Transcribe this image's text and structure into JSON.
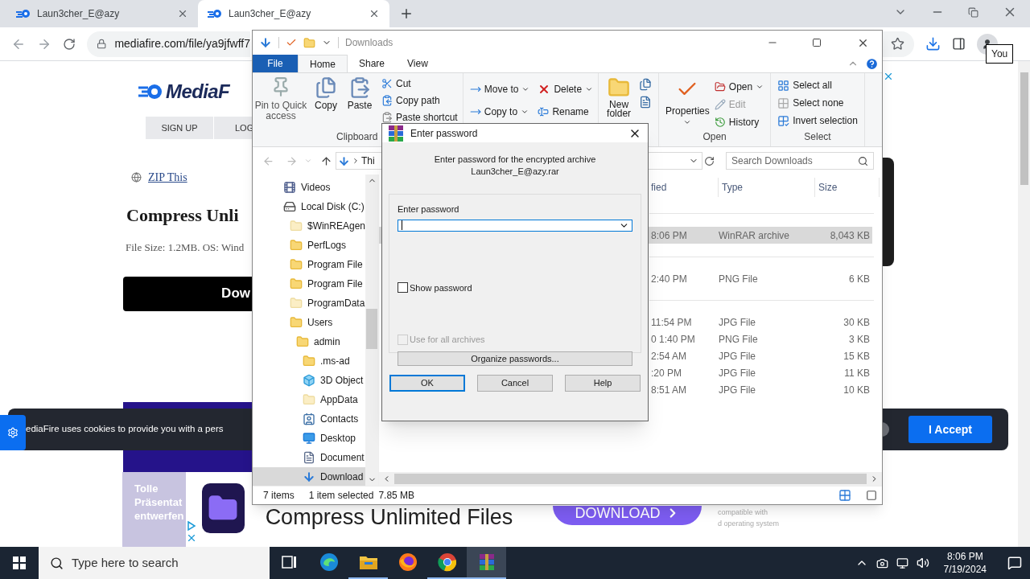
{
  "browser": {
    "tabs": [
      {
        "title": "Laun3cher_E@azy",
        "selected": false
      },
      {
        "title": "Laun3cher_E@azy",
        "selected": true
      }
    ],
    "url": "mediafire.com/file/ya9jfwff7",
    "profile_tooltip": "You"
  },
  "page": {
    "logo": "MediaF",
    "nav": [
      "SIGN UP",
      "LOG"
    ],
    "link": "ZIP This",
    "heading": "Compress Unli",
    "file_info": "File Size: 1.2MB. OS: Wind",
    "download_button": "Dow"
  },
  "cookie_bar": {
    "text": "ediaFire uses cookies to provide you with a pers",
    "accept": "I Accept"
  },
  "ad": {
    "side_text": [
      "Tolle",
      "Präsentat",
      "entwerfen"
    ],
    "headline": "Compress Unlimited Files",
    "button": "DOWNLOAD",
    "fine_print": [
      "compatible with",
      "d operating system"
    ]
  },
  "explorer": {
    "title": "Downloads",
    "file_tab": "File",
    "ribbon_tabs": [
      {
        "label": "Home",
        "selected": true
      },
      {
        "label": "Share",
        "selected": false
      },
      {
        "label": "View",
        "selected": false
      }
    ],
    "clipboard": {
      "big": [
        "Pin to Quick access",
        "Copy",
        "Paste"
      ],
      "small": [
        "Cut",
        "Copy path",
        "Paste shortcut"
      ],
      "label": "Clipboard"
    },
    "organize": [
      "Move to",
      "Copy to",
      "Delete",
      "Rename"
    ],
    "new_folder": "New folder",
    "open": {
      "big": "Properties",
      "small": [
        {
          "label": "Open",
          "disabled": false
        },
        {
          "label": "Edit",
          "disabled": true
        },
        {
          "label": "History",
          "disabled": false
        }
      ],
      "label": "Open"
    },
    "select": {
      "items": [
        "Select all",
        "Select none",
        "Invert selection"
      ],
      "label": "Select"
    },
    "address": "Thi",
    "search_placeholder": "Search Downloads",
    "tree": [
      {
        "label": "Videos",
        "kind": "videos",
        "selected": false
      },
      {
        "label": "Local Disk (C:)",
        "kind": "disk",
        "selected": false,
        "children": [
          {
            "label": "$WinREAgen",
            "kind": "hidden_folder",
            "selected": false
          },
          {
            "label": "PerfLogs",
            "kind": "folder",
            "selected": false
          },
          {
            "label": "Program File",
            "kind": "folder",
            "selected": false
          },
          {
            "label": "Program File",
            "kind": "folder",
            "selected": false
          },
          {
            "label": "ProgramData",
            "kind": "hidden_folder",
            "selected": false
          },
          {
            "label": "Users",
            "kind": "folder",
            "selected": false,
            "children": [
              {
                "label": "admin",
                "kind": "folder",
                "selected": false,
                "children": [
                  {
                    "label": ".ms-ad",
                    "kind": "folder",
                    "selected": false
                  },
                  {
                    "label": "3D Object",
                    "kind": "objects3d",
                    "selected": false
                  },
                  {
                    "label": "AppData",
                    "kind": "hidden_folder",
                    "selected": false
                  },
                  {
                    "label": "Contacts",
                    "kind": "contacts",
                    "selected": false
                  },
                  {
                    "label": "Desktop",
                    "kind": "desktop",
                    "selected": false
                  },
                  {
                    "label": "Document",
                    "kind": "documents",
                    "selected": false
                  },
                  {
                    "label": "Download",
                    "kind": "downloads",
                    "selected": true
                  }
                ]
              }
            ]
          }
        ]
      }
    ],
    "columns": [
      "fied",
      "Type",
      "Size"
    ],
    "groups": [
      {
        "files": [
          {
            "modified": "8:06 PM",
            "type": "WinRAR archive",
            "size": "8,043 KB",
            "selected": true
          }
        ]
      },
      {
        "files": [
          {
            "modified": "2:40 PM",
            "type": "PNG File",
            "size": "6 KB",
            "selected": false
          }
        ]
      },
      {
        "files": [
          {
            "modified": "11:54 PM",
            "type": "JPG File",
            "size": "30 KB",
            "selected": false
          },
          {
            "modified": "0 1:40 PM",
            "type": "PNG File",
            "size": "3 KB",
            "selected": false
          },
          {
            "modified": "2:54 AM",
            "type": "JPG File",
            "size": "15 KB",
            "selected": false
          },
          {
            "modified": ":20 PM",
            "type": "JPG File",
            "size": "11 KB",
            "selected": false
          },
          {
            "modified": "8:51 AM",
            "type": "JPG File",
            "size": "10 KB",
            "selected": false
          }
        ]
      }
    ],
    "status": {
      "count": "7 items",
      "selection": "1 item selected",
      "size": "7.85 MB"
    }
  },
  "dialog": {
    "title": "Enter password",
    "message": "Enter password for the encrypted archive",
    "archive": "Laun3cher_E@azy.rar",
    "field_label": "Enter password",
    "show_password": {
      "label": "Show password",
      "checked": false,
      "disabled": false
    },
    "use_for_all": {
      "label": "Use for all archives",
      "checked": false,
      "disabled": true
    },
    "organize": "Organize passwords...",
    "buttons": [
      {
        "label": "OK",
        "default": true
      },
      {
        "label": "Cancel",
        "default": false
      },
      {
        "label": "Help",
        "default": false
      }
    ]
  },
  "taskbar": {
    "search_placeholder": "Type here to search",
    "apps": [
      {
        "kind": "task_view",
        "running": false,
        "selected": false
      },
      {
        "kind": "edge",
        "running": false,
        "selected": false
      },
      {
        "kind": "explorer",
        "running": true,
        "selected": false
      },
      {
        "kind": "firefox",
        "running": false,
        "selected": false
      },
      {
        "kind": "chrome",
        "running": true,
        "selected": false
      },
      {
        "kind": "winrar",
        "running": true,
        "selected": true
      }
    ],
    "time": "8:06 PM",
    "date": "7/19/2024"
  }
}
